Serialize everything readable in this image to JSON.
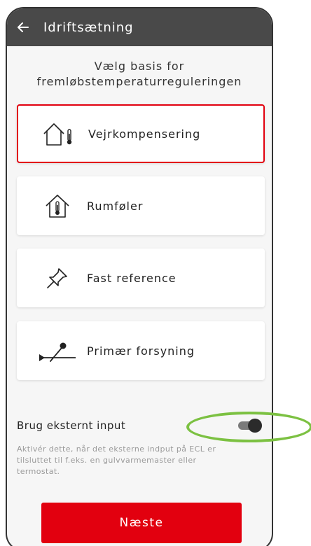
{
  "header": {
    "title": "Idriftsætning",
    "back_icon": "arrow-left-icon"
  },
  "heading": {
    "line1": "Vælg basis for",
    "line2": "fremløbstemperaturreguleringen"
  },
  "options": [
    {
      "label": "Vejrkompensering",
      "icon": "house-thermometer-icon",
      "selected": true
    },
    {
      "label": "Rumføler",
      "icon": "house-sensor-icon",
      "selected": false
    },
    {
      "label": "Fast reference",
      "icon": "pushpin-icon",
      "selected": false
    },
    {
      "label": "Primær forsyning",
      "icon": "primary-supply-icon",
      "selected": false
    }
  ],
  "external_input": {
    "label": "Brug eksternt input",
    "enabled": true,
    "helper": "Aktivér dette, når det eksterne indput på ECL er tilsluttet til f.eks. en gulvvarmemaster eller termostat."
  },
  "next_button": {
    "label": "Næste"
  },
  "colors": {
    "accent": "#e2000f",
    "topbar": "#494949",
    "highlight": "#7cc142"
  }
}
